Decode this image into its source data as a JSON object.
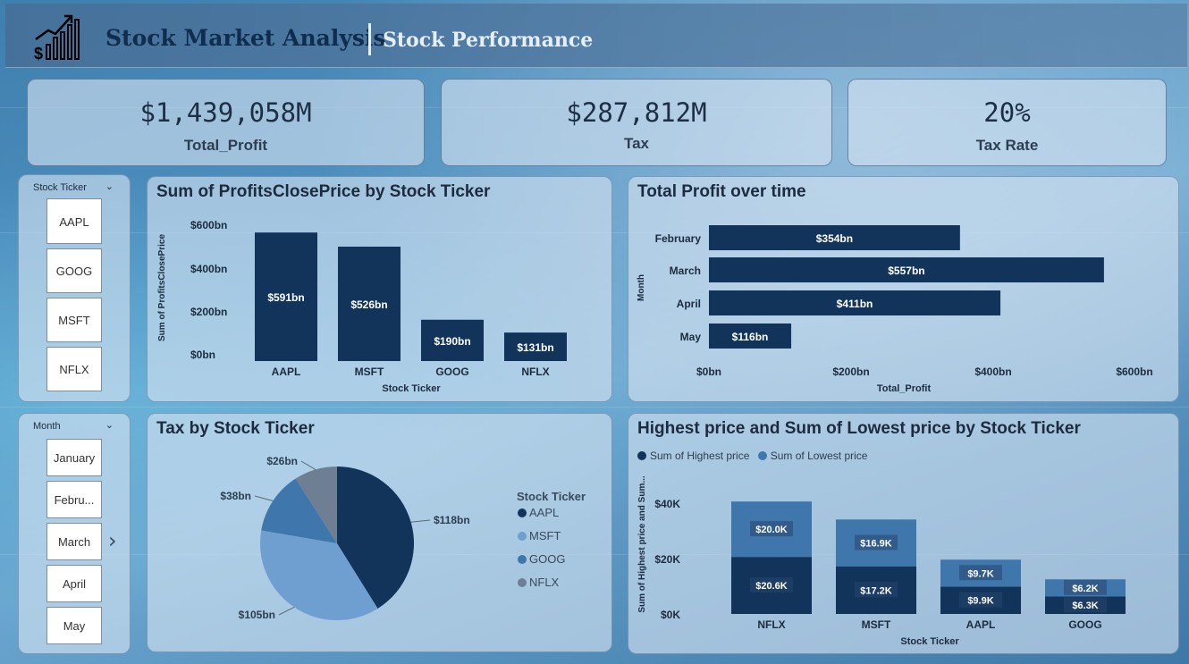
{
  "header": {
    "title": "Stock Market Analysis",
    "subtitle": "Stock Performance"
  },
  "kpis": [
    {
      "value": "$1,439,058M",
      "label": "Total_Profit"
    },
    {
      "value": "$287,812M",
      "label": "Tax"
    },
    {
      "value": "20%",
      "label": "Tax Rate"
    }
  ],
  "ticker_slicer": {
    "header": "Stock Ticker",
    "items": [
      "AAPL",
      "GOOG",
      "MSFT",
      "NFLX"
    ]
  },
  "month_slicer": {
    "header": "Month",
    "items": [
      "January",
      "Febru...",
      "March",
      "April",
      "May"
    ],
    "expand_indicator": "›"
  },
  "colors": {
    "dark_navy": "#12345a",
    "medium_blue": "#3f77ad",
    "light_blue": "#6e9fd0",
    "slate": "#6f7f93",
    "panel_bg": "#d6e4f2"
  },
  "charts": {
    "profits_by_ticker": {
      "title": "Sum of ProfitsClosePrice by Stock Ticker",
      "xlabel": "Stock Ticker",
      "ylabel": "Sum of ProfitsClosePrice",
      "ytick_labels": [
        "$600bn",
        "$400bn",
        "$200bn",
        "$0bn"
      ],
      "data_labels": [
        "$591bn",
        "$526bn",
        "$190bn",
        "$131bn"
      ]
    },
    "profit_over_time": {
      "title": "Total Profit over time",
      "xlabel": "Total_Profit",
      "ylabel": "Month",
      "xtick_labels": [
        "$0bn",
        "$200bn",
        "$400bn",
        "$600bn"
      ],
      "data_labels": [
        "$354bn",
        "$557bn",
        "$411bn",
        "$116bn"
      ]
    },
    "tax_by_ticker": {
      "title": "Tax by Stock Ticker",
      "legend_title": "Stock Ticker",
      "data_labels": [
        "$118bn",
        "$105bn",
        "$38bn",
        "$26bn"
      ]
    },
    "high_low_by_ticker": {
      "title": "Highest price and Sum of Lowest price by Stock Ticker",
      "xlabel": "Stock Ticker",
      "ylabel": "Sum of Highest price and Sum...",
      "ytick_labels": [
        "$40K",
        "$20K",
        "$0K"
      ],
      "legend": [
        "Sum of Highest price",
        "Sum of Lowest price"
      ],
      "high_labels": [
        "$20.6K",
        "$17.2K",
        "$9.9K",
        "$6.3K"
      ],
      "low_labels": [
        "$20.0K",
        "$16.9K",
        "$9.7K",
        "$6.2K"
      ]
    }
  },
  "chart_data": [
    {
      "type": "bar",
      "title": "Sum of ProfitsClosePrice by Stock Ticker",
      "xlabel": "Stock Ticker",
      "ylabel": "Sum of ProfitsClosePrice",
      "categories": [
        "AAPL",
        "MSFT",
        "GOOG",
        "NFLX"
      ],
      "values": [
        591,
        526,
        190,
        131
      ],
      "ylim": [
        0,
        600
      ]
    },
    {
      "type": "bar",
      "orientation": "horizontal",
      "title": "Total Profit over time",
      "xlabel": "Total_Profit",
      "ylabel": "Month",
      "categories": [
        "February",
        "March",
        "April",
        "May"
      ],
      "values": [
        354,
        557,
        411,
        116
      ],
      "xlim": [
        0,
        600
      ]
    },
    {
      "type": "pie",
      "title": "Tax by Stock Ticker",
      "legend_title": "Stock Ticker",
      "categories": [
        "AAPL",
        "MSFT",
        "GOOG",
        "NFLX"
      ],
      "values": [
        118,
        105,
        38,
        26
      ]
    },
    {
      "type": "bar",
      "stacked": true,
      "title": "Highest price and Sum of Lowest price by Stock Ticker",
      "xlabel": "Stock Ticker",
      "ylabel": "Sum of Highest price and Sum...",
      "categories": [
        "NFLX",
        "MSFT",
        "AAPL",
        "GOOG"
      ],
      "series": [
        {
          "name": "Sum of Highest price",
          "values": [
            20.6,
            17.2,
            9.9,
            6.3
          ]
        },
        {
          "name": "Sum of Lowest price",
          "values": [
            20.0,
            16.9,
            9.7,
            6.2
          ]
        }
      ],
      "ylim": [
        0,
        40
      ],
      "legend": "top-left"
    }
  ]
}
